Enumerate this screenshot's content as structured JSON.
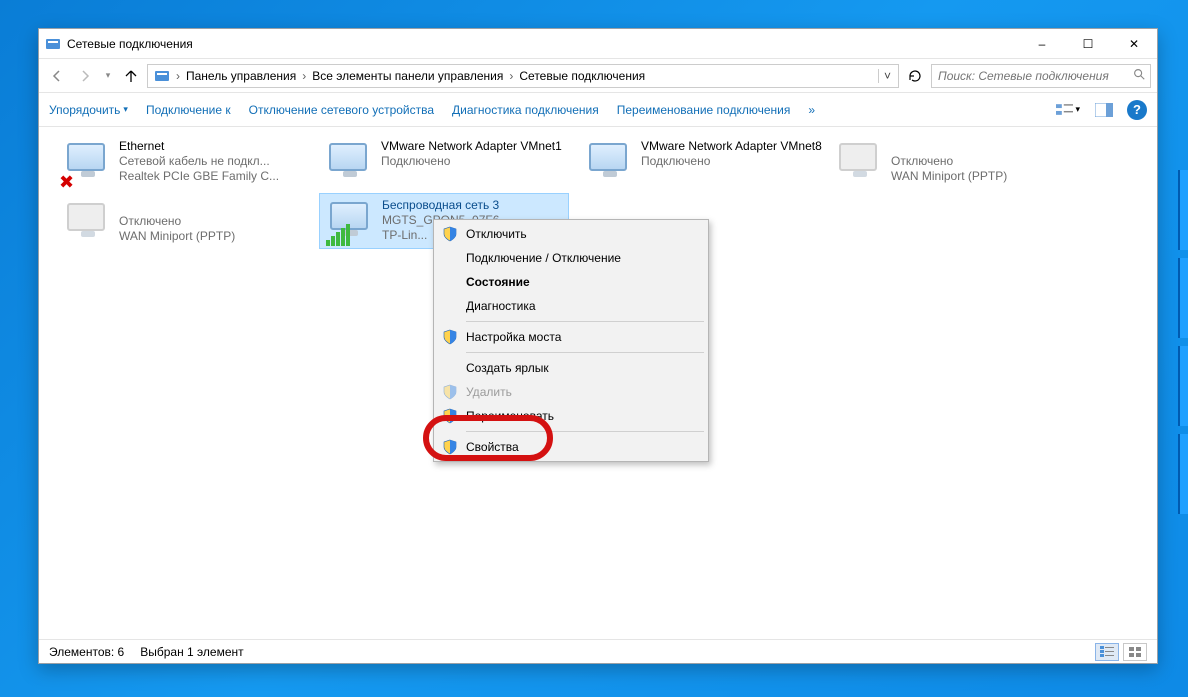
{
  "window": {
    "title": "Сетевые подключения",
    "minimize": "–",
    "maximize": "☐",
    "close": "✕"
  },
  "breadcrumb": {
    "items": [
      "Панель управления",
      "Все элементы панели управления",
      "Сетевые подключения"
    ]
  },
  "search": {
    "placeholder": "Поиск: Сетевые подключения"
  },
  "toolbar": {
    "organize": "Упорядочить",
    "connect": "Подключение к",
    "disconnect": "Отключение сетевого устройства",
    "diagnose": "Диагностика подключения",
    "rename": "Переименование подключения",
    "more": "»"
  },
  "connections": [
    {
      "name": "Ethernet",
      "status": "Сетевой кабель не подкл...",
      "device": "Realtek PCIe GBE Family C...",
      "overlay": "x"
    },
    {
      "name": "VMware Network Adapter VMnet1",
      "status": "Подключено",
      "device": "",
      "overlay": ""
    },
    {
      "name": "VMware Network Adapter VMnet8",
      "status": "Подключено",
      "device": "",
      "overlay": ""
    },
    {
      "name": "",
      "status": "Отключено",
      "device": "WAN Miniport (PPTP)",
      "overlay": "dim"
    },
    {
      "name": "",
      "status": "Отключено",
      "device": "WAN Miniport (PPTP)",
      "overlay": "dim"
    },
    {
      "name": "Беспроводная сеть 3",
      "status": "MGTS_GPON5_07F6",
      "device": "TP-Lin...",
      "overlay": "wifi"
    }
  ],
  "context_menu": {
    "disconnect": "Отключить",
    "conn_toggle": "Подключение / Отключение",
    "state": "Состояние",
    "diag": "Диагностика",
    "bridge": "Настройка моста",
    "shortcut": "Создать ярлык",
    "delete": "Удалить",
    "rename": "Переименовать",
    "properties": "Свойства"
  },
  "statusbar": {
    "count": "Элементов: 6",
    "selected": "Выбран 1 элемент"
  }
}
